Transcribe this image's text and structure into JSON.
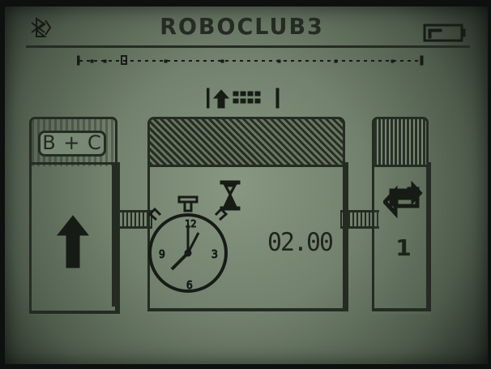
{
  "status": {
    "brick_name": "ROBOCLUB3",
    "bluetooth_icon": "bluetooth-icon",
    "battery_icon": "battery-icon"
  },
  "program": {
    "timeline_icon": "program-timeline-icon",
    "selector_icon": "forward-display-icon"
  },
  "motor_block": {
    "ports": "B + C",
    "direction_icon": "up-arrow-icon"
  },
  "wait_block": {
    "mode_icon": "hourglass-icon",
    "timer_icon": "stopwatch-icon",
    "duration": "02.00"
  },
  "loop_block": {
    "icon": "repeat-icon",
    "count": "1"
  },
  "colors": {
    "lcd_background": "#7f8f79",
    "lcd_ink": "#171b16"
  }
}
